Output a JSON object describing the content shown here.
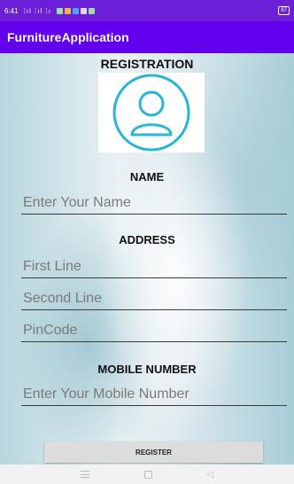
{
  "status_bar": {
    "time": "6:41",
    "signal": "⁞ıl ⁞ıl ⁞ı",
    "battery": "87"
  },
  "app_bar": {
    "title": "FurnitureApplication"
  },
  "form": {
    "heading": "REGISTRATION",
    "name_label": "NAME",
    "name_placeholder": "Enter Your Name",
    "address_label": "ADDRESS",
    "address_line1_placeholder": "First Line",
    "address_line2_placeholder": "Second Line",
    "pincode_placeholder": "PinCode",
    "mobile_label": "MOBILE NUMBER",
    "mobile_placeholder": "Enter Your Mobile Number",
    "register_label": "REGISTER"
  },
  "colors": {
    "app_bar": "#6200ee",
    "avatar_icon": "#29b6d6"
  },
  "icons": {
    "avatar": "person-outline-icon",
    "nav_menu": "menu-icon",
    "nav_home": "home-square-icon",
    "nav_back": "back-triangle-icon"
  }
}
